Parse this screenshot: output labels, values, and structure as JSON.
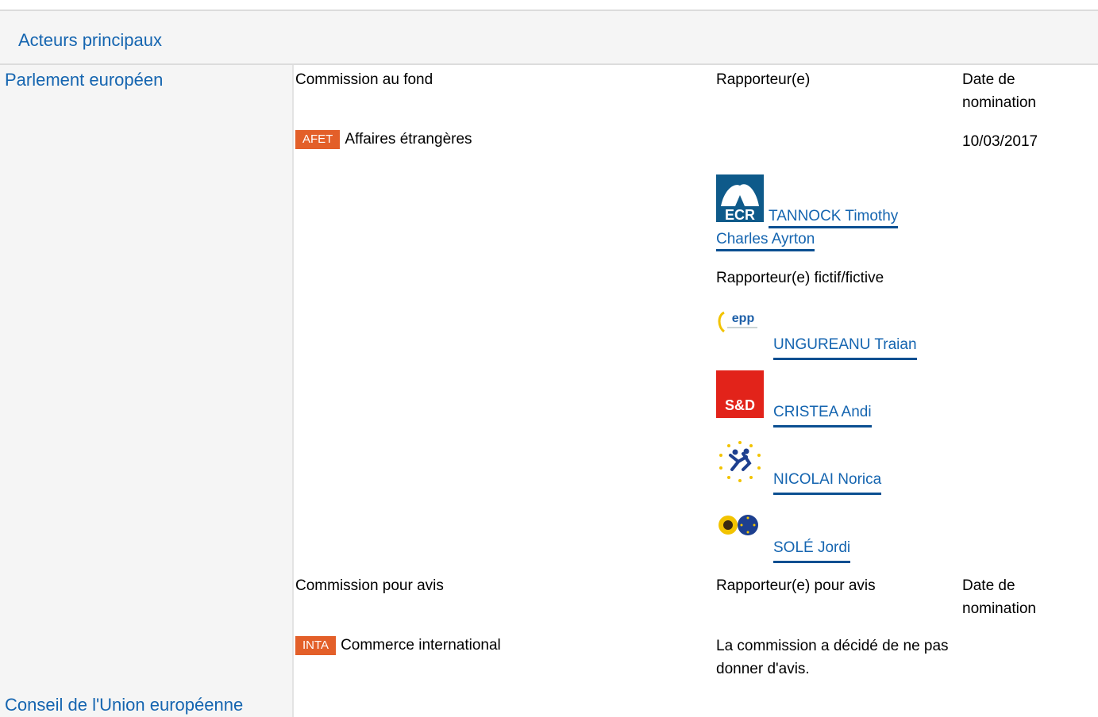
{
  "panel": {
    "title": "Acteurs principaux"
  },
  "sections": {
    "parliament": "Parlement européen",
    "council": "Conseil de l'Union européenne"
  },
  "lead_committee": {
    "header_committee": "Commission au fond",
    "header_rapporteur": "Rapporteur(e)",
    "header_date": "Date de nomination",
    "badge": "AFET",
    "name": "Affaires étrangères",
    "date": "10/03/2017",
    "rapporteur": {
      "group_logo": "ECR",
      "name": "TANNOCK Timothy Charles Ayrton"
    },
    "shadow_label": "Rapporteur(e) fictif/fictive",
    "shadows": [
      {
        "group_logo": "epp",
        "name": "UNGUREANU Traian"
      },
      {
        "group_logo": "S&D",
        "name": "CRISTEA Andi"
      },
      {
        "group_logo": "alde-stars-icon",
        "name": "NICOLAI Norica"
      },
      {
        "group_logo": "greens-efa-icon",
        "name": "SOLÉ Jordi"
      }
    ]
  },
  "opinion_committee": {
    "header_committee": "Commission pour avis",
    "header_rapporteur": "Rapporteur(e) pour avis",
    "header_date": "Date de nomination",
    "badge": "INTA",
    "name": "Commerce international",
    "note": "La commission a décidé de ne pas donner d'avis."
  },
  "colors": {
    "link": "#1565b0",
    "badge": "#e35f29",
    "panel_bg": "#f5f5f5"
  }
}
